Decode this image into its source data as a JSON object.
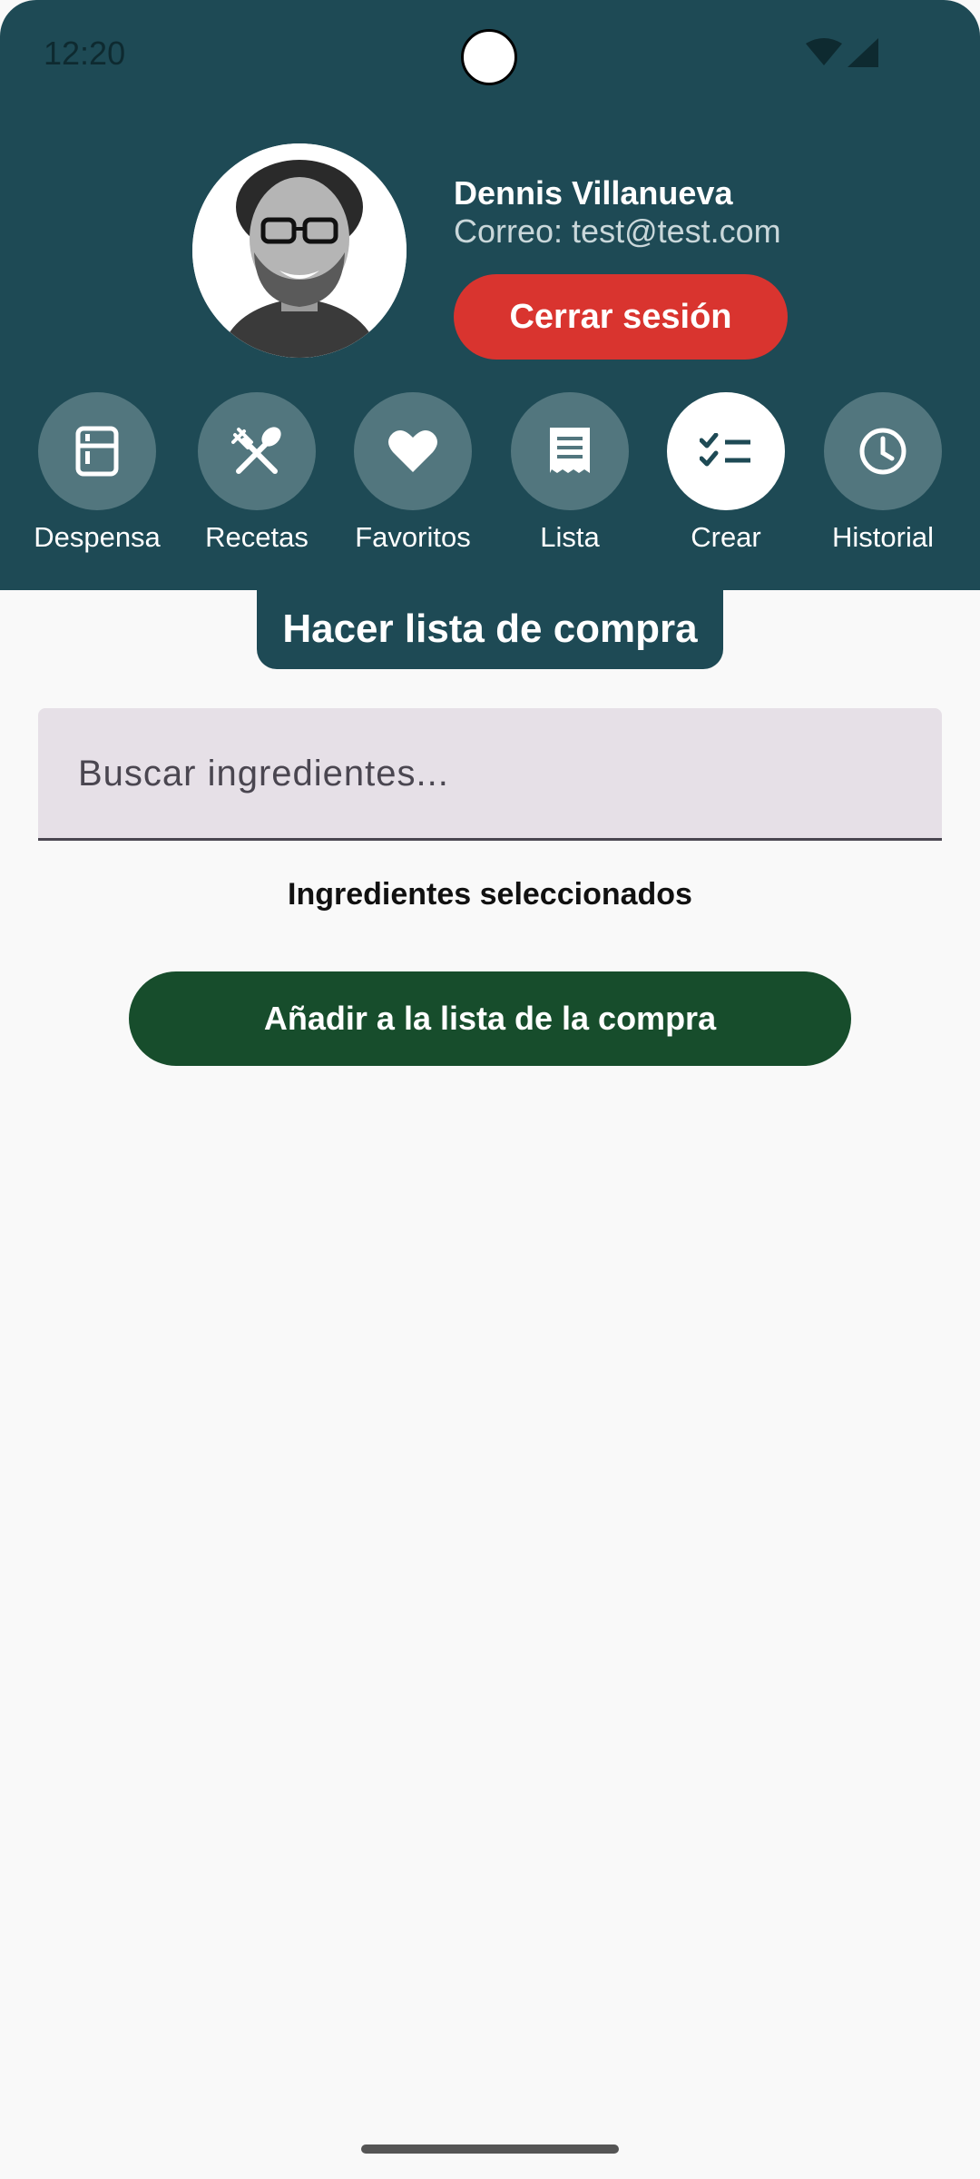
{
  "status_bar": {
    "time": "12:20",
    "icons": [
      "wifi-icon",
      "cell-signal-icon"
    ]
  },
  "profile": {
    "name": "Dennis Villanueva",
    "email": "Correo: test@test.com",
    "logout_label": "Cerrar sesión"
  },
  "nav": {
    "items": [
      {
        "label": "Despensa",
        "icon": "fridge-icon",
        "active": false
      },
      {
        "label": "Recetas",
        "icon": "utensils-icon",
        "active": false
      },
      {
        "label": "Favoritos",
        "icon": "heart-icon",
        "active": false
      },
      {
        "label": "Lista",
        "icon": "receipt-icon",
        "active": false
      },
      {
        "label": "Crear",
        "icon": "checklist-icon",
        "active": true
      },
      {
        "label": "Historial",
        "icon": "clock-icon",
        "active": false
      }
    ]
  },
  "page": {
    "title": "Hacer lista de compra"
  },
  "search": {
    "placeholder": "Buscar ingredientes...",
    "value": ""
  },
  "selected_section": {
    "title": "Ingredientes seleccionados"
  },
  "actions": {
    "add_label": "Añadir a la lista de la compra"
  },
  "colors": {
    "header": "#1e4a55",
    "nav_circle": "#52767e",
    "logout": "#d9342f",
    "add_button": "#174d2c",
    "background": "#f9f9f9"
  }
}
